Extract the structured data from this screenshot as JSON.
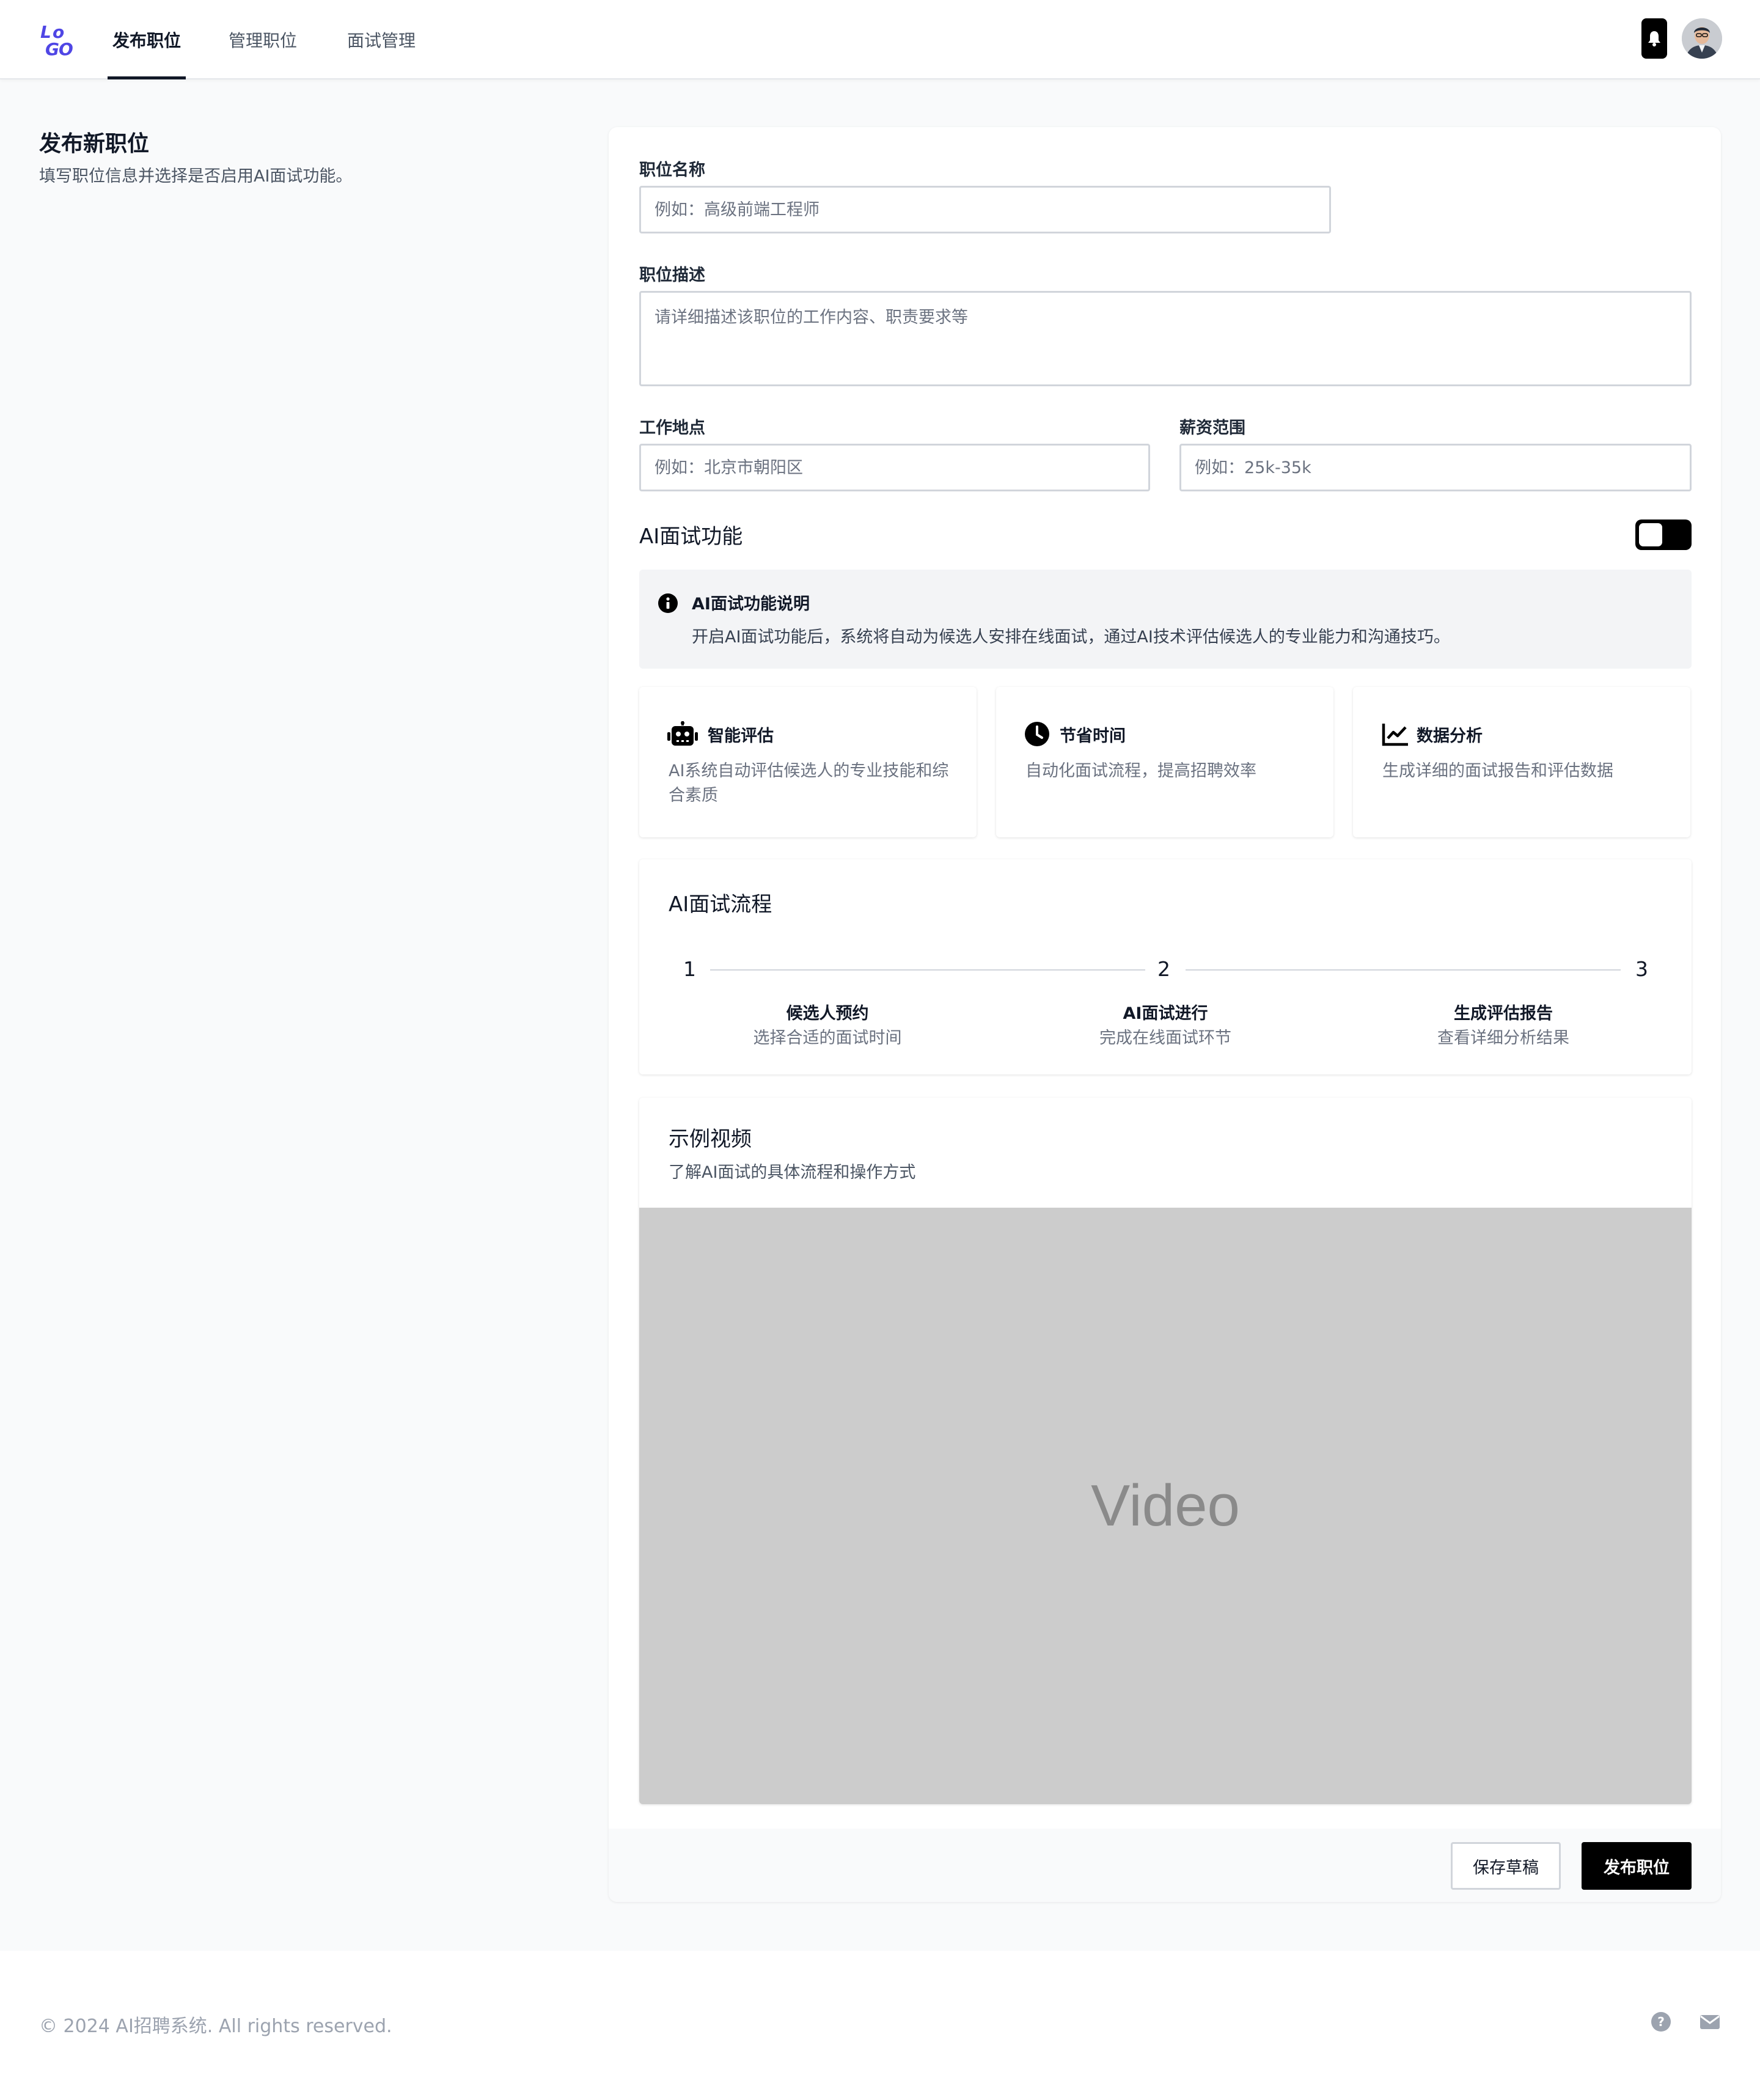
{
  "header": {
    "logo_text": "LOGO",
    "tabs": [
      {
        "label": "发布职位",
        "active": true
      },
      {
        "label": "管理职位",
        "active": false
      },
      {
        "label": "面试管理",
        "active": false
      }
    ],
    "icons": [
      "bell-icon",
      "avatar"
    ]
  },
  "intro": {
    "title": "发布新职位",
    "subtitle": "填写职位信息并选择是否启用AI面试功能。"
  },
  "form": {
    "job_title": {
      "label": "职位名称",
      "placeholder": "例如：高级前端工程师",
      "value": ""
    },
    "job_description": {
      "label": "职位描述",
      "placeholder": "请详细描述该职位的工作内容、职责要求等",
      "value": ""
    },
    "location": {
      "label": "工作地点",
      "placeholder": "例如：北京市朝阳区",
      "value": ""
    },
    "salary": {
      "label": "薪资范围",
      "placeholder": "例如：25k-35k",
      "value": ""
    }
  },
  "ai_interview": {
    "heading": "AI面试功能",
    "enabled": false,
    "info_title": "AI面试功能说明",
    "info_text": "开启AI面试功能后，系统将自动为候选人安排在线面试，通过AI技术评估候选人的专业能力和沟通技巧。",
    "features": [
      {
        "icon": "robot-icon",
        "title": "智能评估",
        "desc": "AI系统自动评估候选人的专业技能和综合素质"
      },
      {
        "icon": "clock-icon",
        "title": "节省时间",
        "desc": "自动化面试流程，提高招聘效率"
      },
      {
        "icon": "chart-line-icon",
        "title": "数据分析",
        "desc": "生成详细的面试报告和评估数据"
      }
    ]
  },
  "process": {
    "heading": "AI面试流程",
    "steps": [
      {
        "number": "1",
        "title": "候选人预约",
        "desc": "选择合适的面试时间"
      },
      {
        "number": "2",
        "title": "AI面试进行",
        "desc": "完成在线面试环节"
      },
      {
        "number": "3",
        "title": "生成评估报告",
        "desc": "查看详细分析结果"
      }
    ]
  },
  "video": {
    "heading": "示例视频",
    "subtitle": "了解AI面试的具体流程和操作方式",
    "placeholder_text": "Video"
  },
  "actions": {
    "save_draft": "保存草稿",
    "publish": "发布职位"
  },
  "footer": {
    "copyright": "© 2024 AI招聘系统. All rights reserved.",
    "icons": [
      "help-icon",
      "mail-icon"
    ]
  },
  "colors": {
    "accent": "#000000",
    "logo": "#4f46e5",
    "video_bg": "#cccccc"
  }
}
